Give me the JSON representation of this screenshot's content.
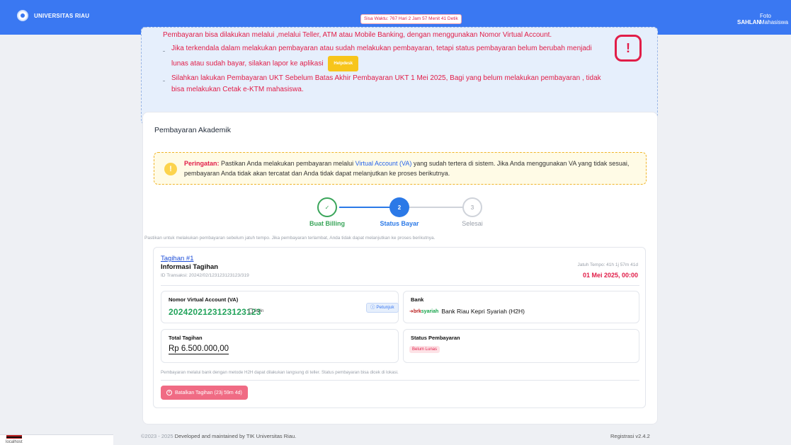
{
  "topbar": {
    "brand": "UNIVERSITAS RIAU",
    "timer": "Sisa Waktu: 767 Hari 2 Jam 57 Menit 41 Detik",
    "user_name": "SAHLAN",
    "photo_alt_line1": "Foto",
    "photo_alt_line2": "Mahasiswa",
    "color": "#3a78f2"
  },
  "info": {
    "line0": "Pembayaran bisa dilakukan melalui ,melalui Teller, ATM atau Mobile Banking, dengan menggunakan Nomor Virtual Account.",
    "line1a": "Jika terkendala dalam melakukan pembayaran atau sudah melakukan pembayaran, tetapi status pembayaran belum berubah menjadi",
    "line1b": "lunas atau sudah bayar, silakan lapor ke aplikasi",
    "helpdesk": "Helpdesk",
    "line2a": "Silahkan lakukan Pembayaran UKT Sebelum Batas Akhir Pembayaran UKT 1 Mei 2025, Bagi yang belum melakukan pembayaran , tidak",
    "line2b": "bisa melakukan Cetak e-KTM mahasiswa."
  },
  "card": {
    "title": "Pembayaran Akademik",
    "warning": {
      "label": "Peringatan:",
      "text1": " Pastikan Anda melakukan pembayaran melalui ",
      "va": "Virtual Account (VA)",
      "text2": " yang sudah tertera di sistem. Jika Anda menggunakan VA yang tidak sesuai, pembayaran Anda tidak akan tercatat dan Anda tidak dapat melanjutkan ke proses berikutnya."
    },
    "steps": [
      {
        "num": "✓",
        "label": "Buat Billing",
        "state": "done"
      },
      {
        "num": "2",
        "label": "Status Bayar",
        "state": "active"
      },
      {
        "num": "3",
        "label": "Selesai",
        "state": "pending"
      }
    ],
    "note": "Pastikan untuk melakukan pembayaran sebelum jatuh tempo. Jika pembayaran terlambat, Anda tidak dapat melanjutkan ke proses berikutnya.",
    "bill": {
      "link": "Tagihan #1",
      "heading": "Informasi Tagihan",
      "id": "ID Transaksi: 20242/02/123123123123/319",
      "due_label": "Jatuh Tempo: 41h 1j 57m 41d",
      "due_date": "01 Mei 2025, 00:00",
      "va_label": "Nomor Virtual Account (VA)",
      "va_number": "2024202123123123123",
      "copy": "Salin",
      "petunjuk": "Petunjuk",
      "bank_label": "Bank",
      "bank_logo_a": "brk",
      "bank_logo_b": "syariah",
      "bank_name": "Bank Riau Kepri Syariah (H2H)",
      "total_label": "Total Tagihan",
      "total": "Rp 6.500.000,00",
      "status_label": "Status Pembayaran",
      "status": "Belum Lunas",
      "footnote": "Pembayaran melalui bank dengan metode H2H dapat dilakukan langsung di teller. Status pembayaran bisa dicek di lokasi.",
      "cancel": "Batalkan Tagihan (23j 59m 4d)"
    }
  },
  "footer": {
    "copyright": "©2023 - 2025",
    "developed": " Developed and maintained by TIK Universitas Riau.",
    "version": "Registrasi  v2.4.2"
  },
  "corner": {
    "text": "localhost"
  }
}
